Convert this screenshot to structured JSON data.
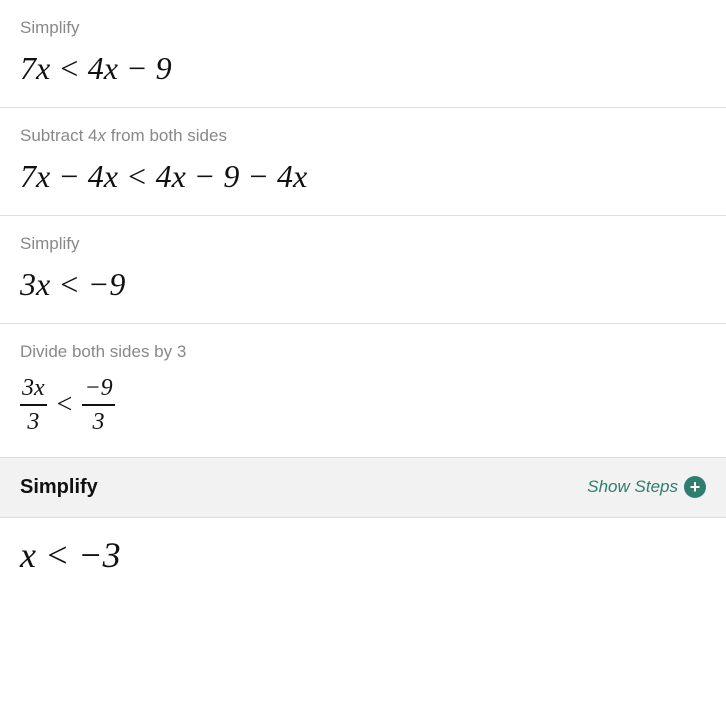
{
  "steps": [
    {
      "id": "step1",
      "label": "Simplify",
      "label_html": "Simplify",
      "expr_type": "simple",
      "expr": "7x < 4x − 9"
    },
    {
      "id": "step2",
      "label_html": "Subtract 4x from both sides",
      "expr_type": "simple",
      "expr": "7x − 4x < 4x − 9 − 4x"
    },
    {
      "id": "step3",
      "label_html": "Simplify",
      "expr_type": "simple",
      "expr": "3x < −9"
    },
    {
      "id": "step4",
      "label_html": "Divide both sides by 3",
      "expr_type": "fraction"
    }
  ],
  "highlighted_step": {
    "title": "Simplify",
    "show_steps_label": "Show Steps"
  },
  "final_expr": "x < −3",
  "colors": {
    "teal": "#2e7d6e",
    "label_gray": "#888888",
    "divider": "#dddddd",
    "highlight_bg": "#f2f2f2"
  }
}
